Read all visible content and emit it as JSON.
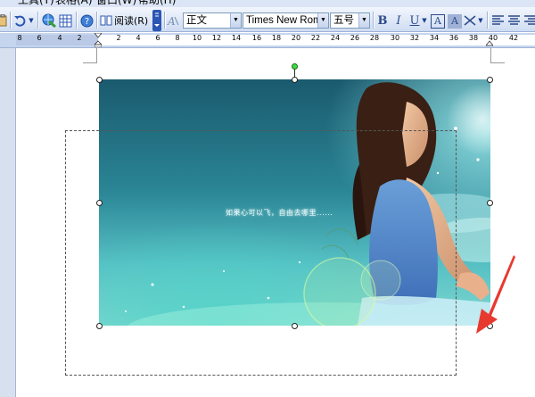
{
  "menubar": {
    "items": [
      {
        "label": "工具(T)"
      },
      {
        "label": "表格(A)"
      },
      {
        "label": "窗口(W)"
      },
      {
        "label": "帮助(H)"
      }
    ]
  },
  "toolbar": {
    "read_label": "阅读(R)",
    "style_value": "正文",
    "font_value": "Times New Roman",
    "size_value": "五号",
    "bold": "B",
    "italic": "I",
    "underline": "U",
    "char_border": "A",
    "char_shading": "A"
  },
  "ruler": {
    "numbers": [
      "8",
      "6",
      "4",
      "2",
      "2",
      "4",
      "6",
      "8",
      "10",
      "12",
      "14",
      "16",
      "18",
      "20",
      "22",
      "24",
      "26",
      "28",
      "30",
      "32",
      "34",
      "36",
      "38",
      "40",
      "42"
    ]
  },
  "picture": {
    "caption": "如果心可以飞，自由去哪里......"
  },
  "colors": {
    "accent_arrow": "#e8392f",
    "rotation_handle": "#3fdc3f"
  }
}
